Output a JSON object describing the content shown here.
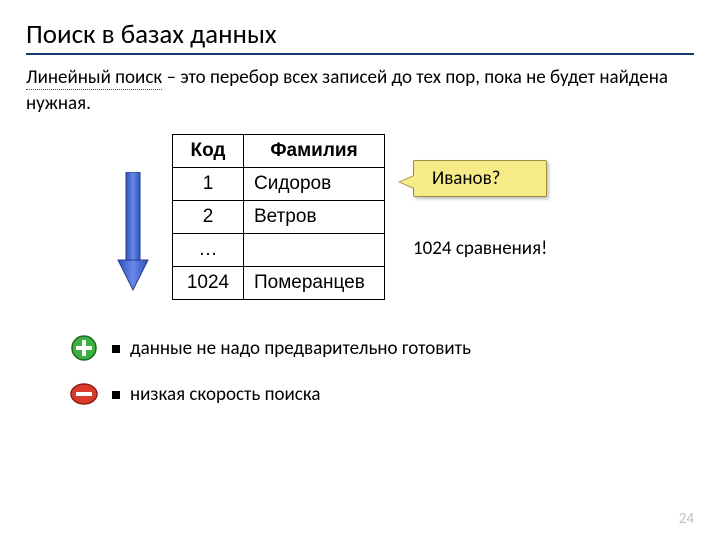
{
  "title": "Поиск в базах данных",
  "intro": {
    "term": "Линейный поиск",
    "rest": " – это перебор всех записей до тех пор, пока не будет найдена нужная."
  },
  "table": {
    "headers": {
      "code": "Код",
      "name": "Фамилия"
    },
    "rows": [
      {
        "code": "1",
        "name": "Сидоров"
      },
      {
        "code": "2",
        "name": "Ветров"
      },
      {
        "code": "…",
        "name": ""
      },
      {
        "code": "1024",
        "name": "Померанцев"
      }
    ]
  },
  "callout": "Иванов?",
  "comparison": "1024 сравнения!",
  "bullets": {
    "plus": "данные не надо предварительно готовить",
    "minus": "низкая скорость поиска"
  },
  "page": "24"
}
